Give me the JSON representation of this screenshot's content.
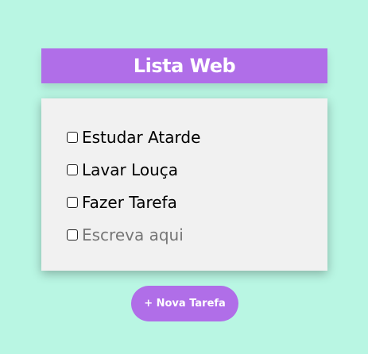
{
  "header": {
    "title": "Lista Web"
  },
  "tasks": [
    {
      "label": "Estudar Atarde"
    },
    {
      "label": "Lavar Louça"
    },
    {
      "label": "Fazer Tarefa"
    }
  ],
  "new_task_input": {
    "placeholder": "Escreva aqui",
    "value": ""
  },
  "new_task_button": {
    "label": "+ Nova Tarefa"
  },
  "colors": {
    "background": "#b9f6e3",
    "accent": "#b06ee8",
    "card": "#f1f1f1"
  }
}
